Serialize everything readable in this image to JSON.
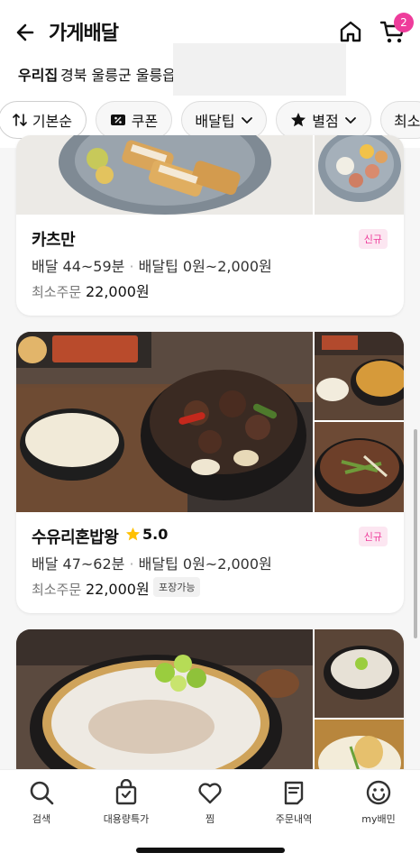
{
  "header": {
    "title": "가게배달",
    "cart_count": "2"
  },
  "address": {
    "label": "우리집",
    "text": "경북 울릉군 울릉읍"
  },
  "filters": [
    {
      "label": "기본순",
      "icon": "sort-icon"
    },
    {
      "label": "쿠폰",
      "icon": "coupon-icon"
    },
    {
      "label": "배달팁",
      "icon": "chevron-down-icon"
    },
    {
      "label": "별점",
      "icon": "star-icon"
    },
    {
      "label": "최소",
      "icon": ""
    }
  ],
  "stores": [
    {
      "name": "카츠만",
      "badge": "신규",
      "delivery_time": "배달 44~59분",
      "delivery_tip": "배달팁 0원~2,000원",
      "min_order_label": "최소주문",
      "min_order_value": "22,000원"
    },
    {
      "name": "수유리혼밥왕",
      "rating": "5.0",
      "badge": "신규",
      "delivery_time": "배달 47~62분",
      "delivery_tip": "배달팁 0원~2,000원",
      "min_order_label": "최소주문",
      "min_order_value": "22,000원",
      "takeout": "포장가능"
    }
  ],
  "bottom_nav": [
    {
      "label": "검색",
      "icon": "search-icon"
    },
    {
      "label": "대용량특가",
      "icon": "shopping-bag-icon"
    },
    {
      "label": "찜",
      "icon": "heart-icon"
    },
    {
      "label": "주문내역",
      "icon": "receipt-icon"
    },
    {
      "label": "my배민",
      "icon": "smile-face-icon"
    }
  ],
  "colors": {
    "accent": "#ee3c9b",
    "star": "#ffc000",
    "badge_bg": "#fce6f1"
  }
}
